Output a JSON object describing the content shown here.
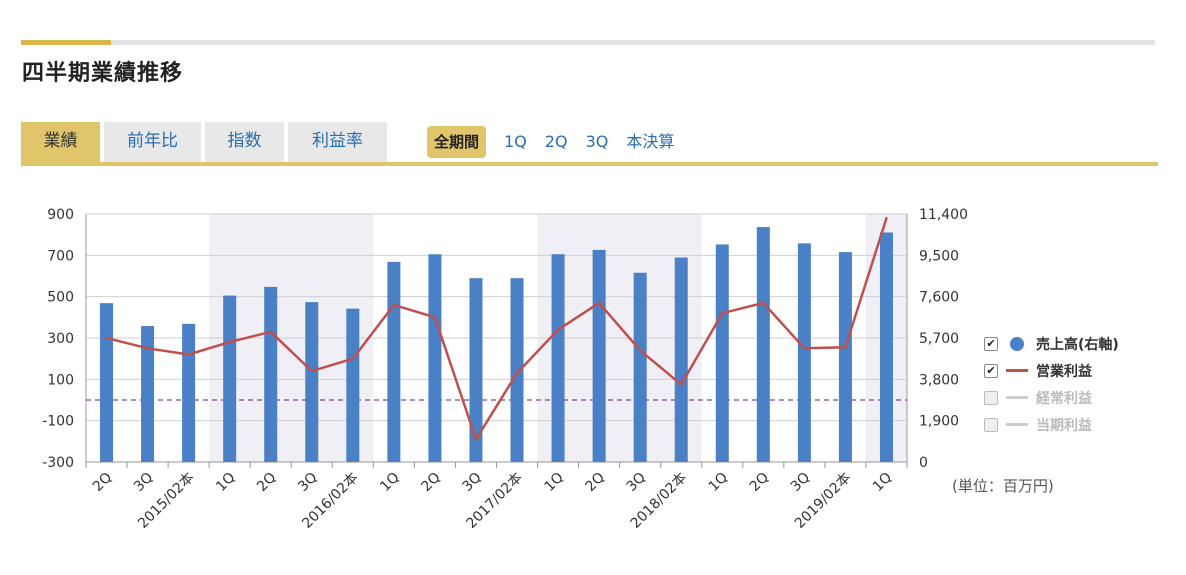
{
  "title": "四半期業績推移",
  "tabs": [
    {
      "label": "業績",
      "active": true
    },
    {
      "label": "前年比",
      "active": false
    },
    {
      "label": "指数",
      "active": false
    },
    {
      "label": "利益率",
      "active": false
    }
  ],
  "periods": [
    {
      "label": "全期間",
      "active": true
    },
    {
      "label": "1Q",
      "active": false
    },
    {
      "label": "2Q",
      "active": false
    },
    {
      "label": "3Q",
      "active": false
    },
    {
      "label": "本決算",
      "active": false
    }
  ],
  "legend": [
    {
      "label": "売上高(右軸)",
      "checked": true,
      "symbol": "dot",
      "color": "#4a80c5"
    },
    {
      "label": "営業利益",
      "checked": true,
      "symbol": "line",
      "color": "#c0504d"
    },
    {
      "label": "経常利益",
      "checked": false,
      "symbol": "line",
      "color": "#cccccc"
    },
    {
      "label": "当期利益",
      "checked": false,
      "symbol": "line",
      "color": "#cccccc"
    }
  ],
  "unit_note": "(単位：百万円)",
  "colors": {
    "accent": "#e1c56a",
    "bar": "#4a80c5",
    "line": "#c0504d",
    "link": "#2a6db0",
    "shade": "#efeff5",
    "zero_line": "#7a4a8a"
  },
  "chart_data": {
    "type": "bar+line",
    "categories": [
      "2Q",
      "3Q",
      "2015/02本",
      "1Q",
      "2Q",
      "3Q",
      "2016/02本",
      "1Q",
      "2Q",
      "3Q",
      "2017/02本",
      "1Q",
      "2Q",
      "3Q",
      "2018/02本",
      "1Q",
      "2Q",
      "3Q",
      "2019/02本",
      "1Q"
    ],
    "shaded_ranges": [
      [
        3,
        6
      ],
      [
        11,
        14
      ],
      [
        19,
        19
      ]
    ],
    "left_axis": {
      "ticks": [
        "900",
        "700",
        "500",
        "300",
        "100",
        "-100",
        "-300"
      ],
      "ylim": [
        -300,
        900
      ]
    },
    "right_axis": {
      "ticks": [
        "11,400",
        "9,500",
        "7,600",
        "5,700",
        "3,800",
        "1,900",
        "0"
      ],
      "ylim": [
        0,
        11400
      ]
    },
    "series": [
      {
        "name": "売上高(右軸)",
        "type": "bar",
        "axis": "right",
        "values": [
          7300,
          6250,
          6350,
          7650,
          8050,
          7350,
          7050,
          9200,
          9550,
          8450,
          8450,
          9550,
          9750,
          8700,
          9400,
          10000,
          10800,
          10050,
          9650,
          10550
        ]
      },
      {
        "name": "営業利益",
        "type": "line",
        "axis": "left",
        "values": [
          300,
          250,
          220,
          280,
          330,
          140,
          200,
          460,
          400,
          -190,
          130,
          340,
          470,
          240,
          75,
          420,
          470,
          250,
          255,
          880
        ]
      }
    ]
  }
}
